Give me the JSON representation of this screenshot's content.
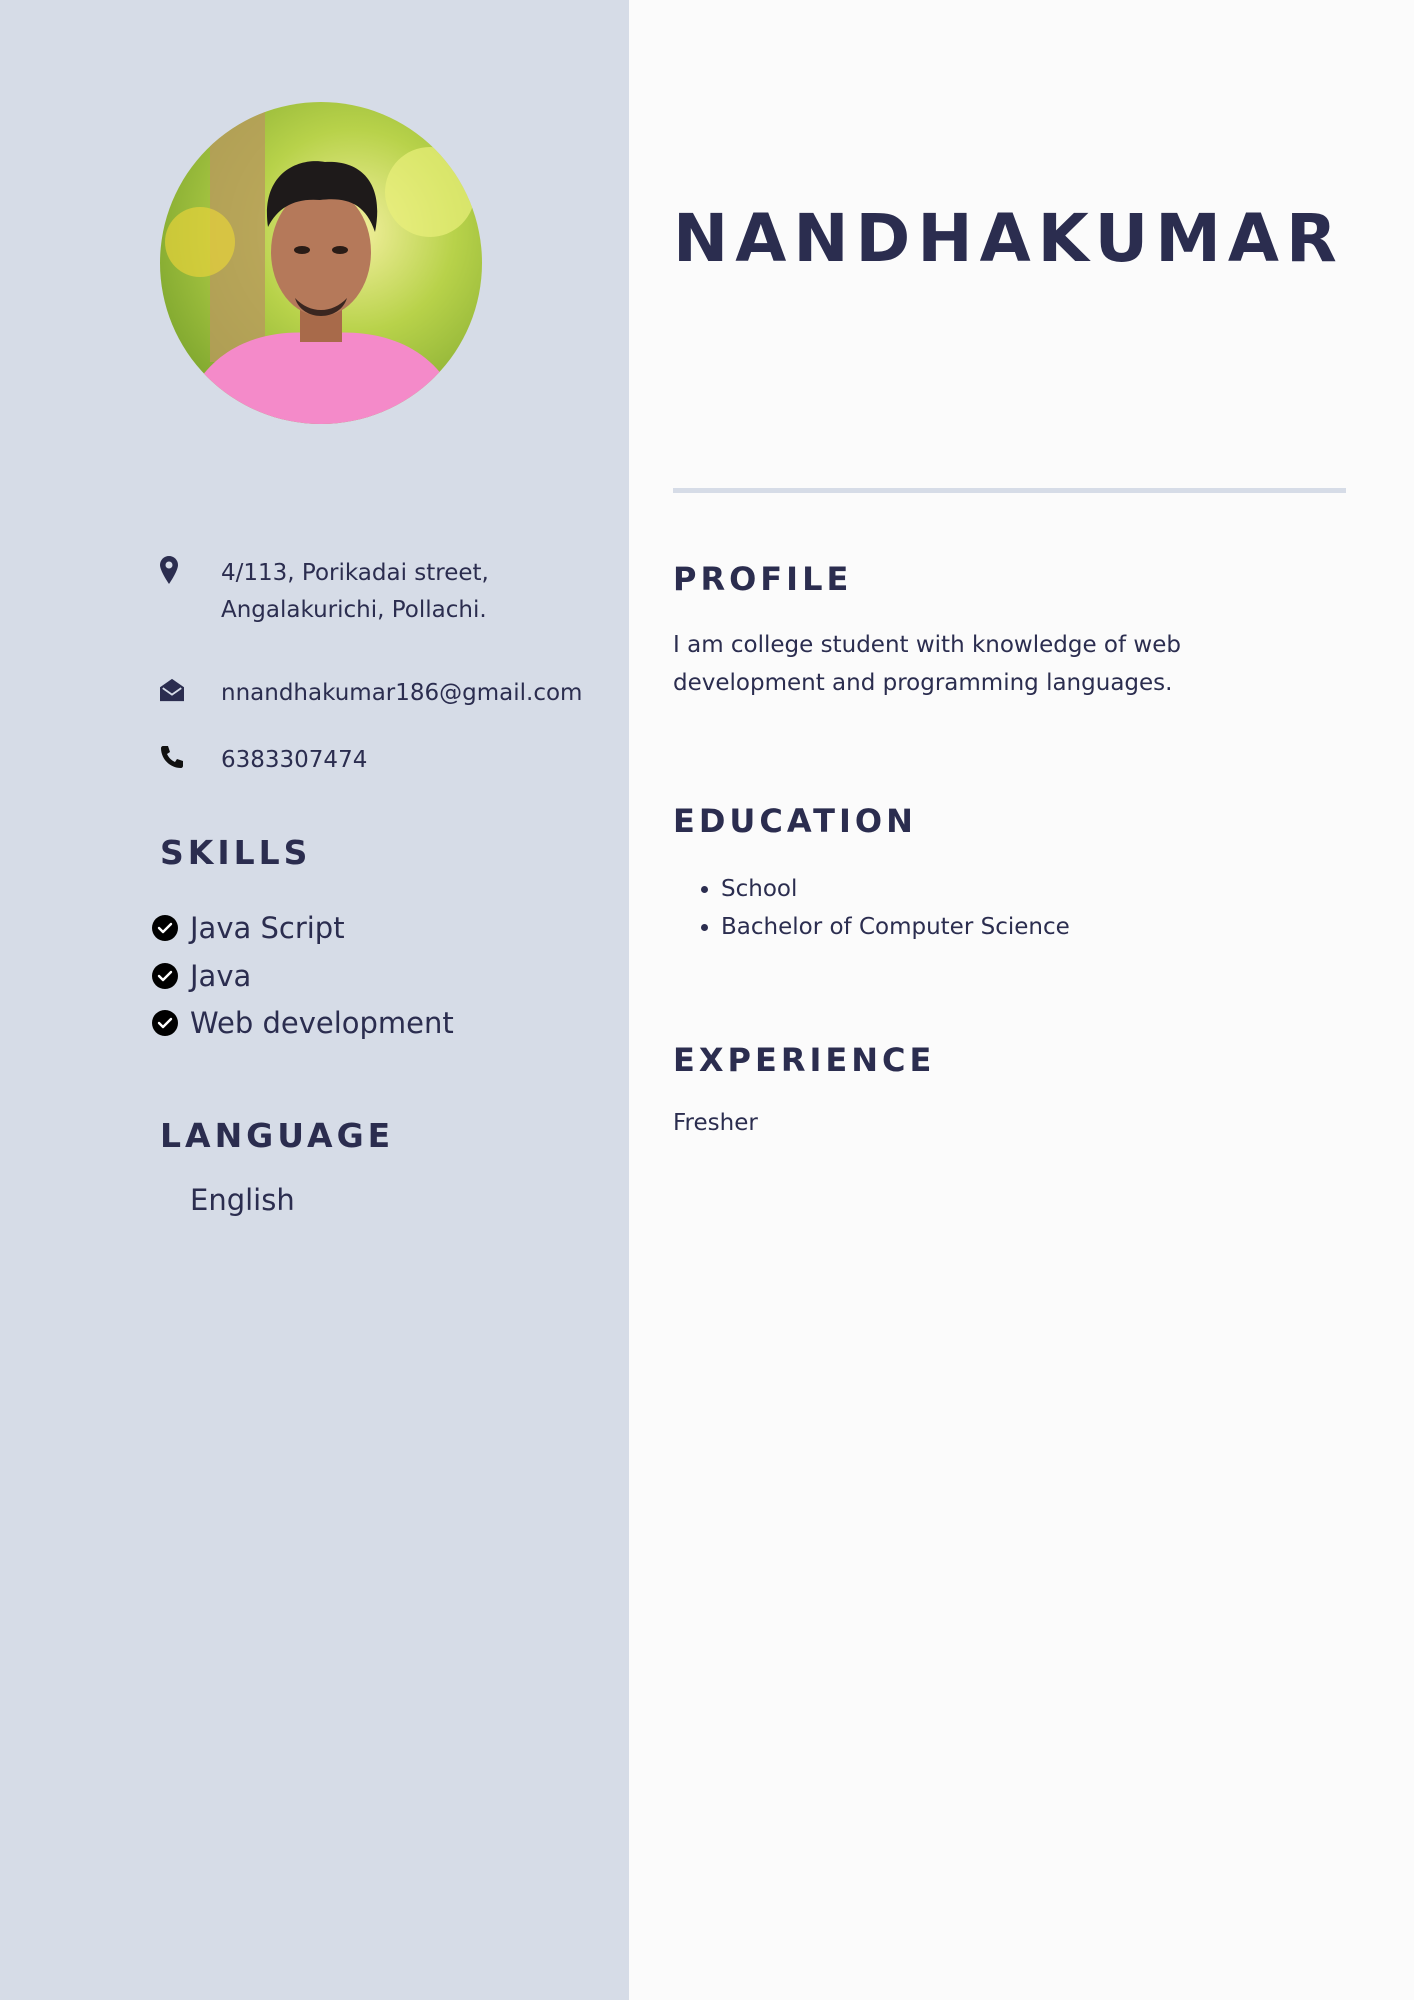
{
  "sidebar": {
    "photo": {
      "alt": "Profile photo"
    },
    "contact": {
      "address": "4/113, Porikadai street,\nAngalakurichi, Pollachi.",
      "email": "nnandhakumar186@gmail.com",
      "phone": "6383307474"
    },
    "skills": {
      "heading": "SKILLS",
      "items": [
        "Java Script",
        "Java",
        "Web development"
      ]
    },
    "language": {
      "heading": "LANGUAGE",
      "items": [
        "English"
      ]
    }
  },
  "main": {
    "name": "NANDHAKUMAR",
    "profile": {
      "heading": "PROFILE",
      "text": " I am college student with knowledge of web development and programming languages."
    },
    "education": {
      "heading": "EDUCATION",
      "items": [
        "School",
        "Bachelor of Computer Science"
      ]
    },
    "experience": {
      "heading": "EXPERIENCE",
      "text": "Fresher"
    }
  },
  "colors": {
    "sidebar_bg": "#d6dce7",
    "text": "#2b2d4f",
    "page_bg": "#fbfbfb"
  },
  "icons": [
    "location-pin-icon",
    "envelope-icon",
    "phone-icon",
    "check-circle-icon"
  ]
}
